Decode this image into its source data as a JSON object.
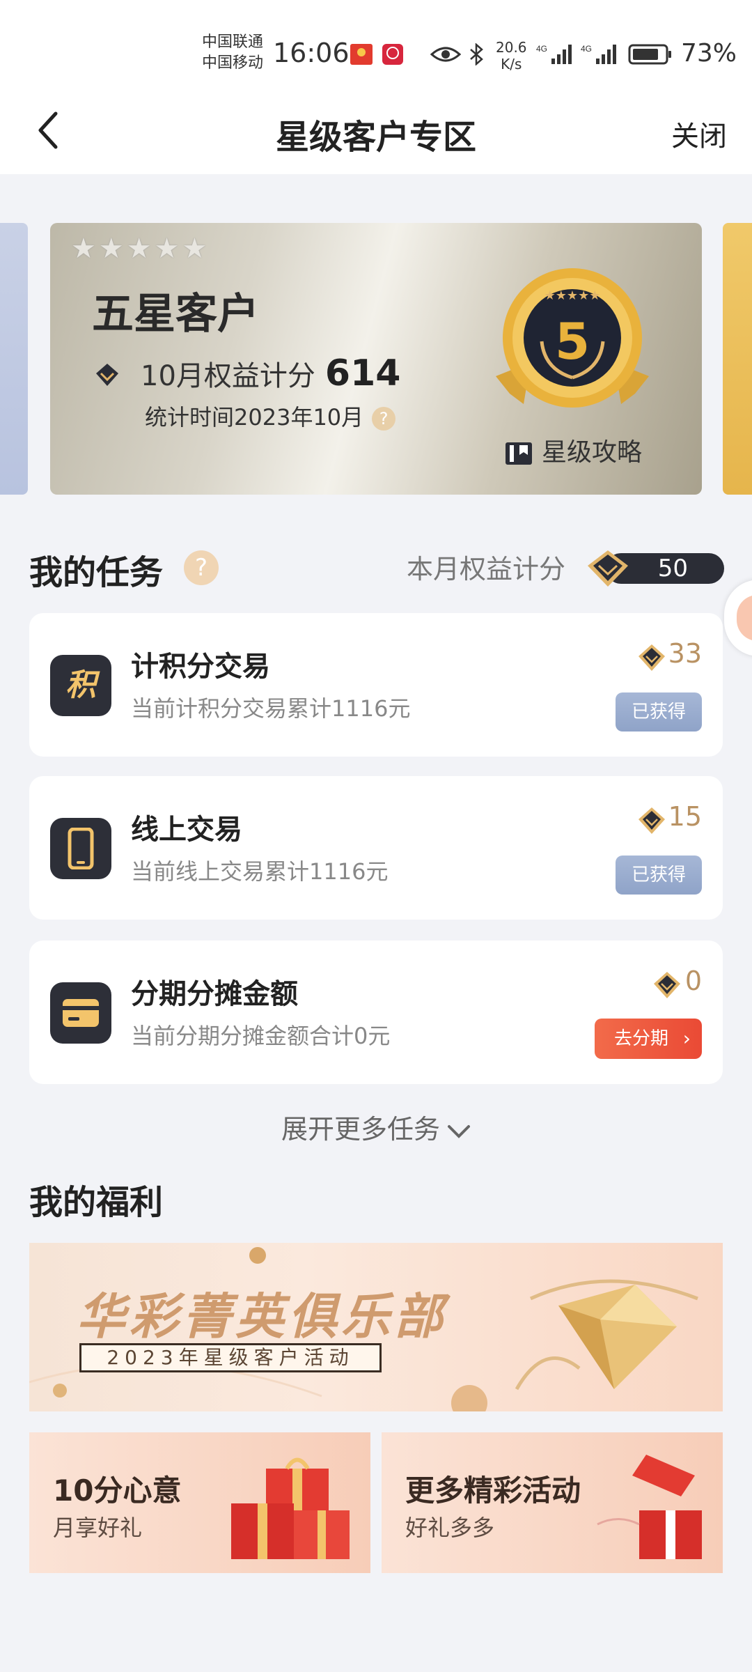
{
  "status": {
    "carrier1": "中国联通",
    "carrier2": "中国移动",
    "time": "16:06",
    "net_speed_value": "20.6",
    "net_speed_unit": "K/s",
    "signal1": "4G",
    "signal2": "4G",
    "battery": "73%"
  },
  "header": {
    "title": "星级客户专区",
    "close_label": "关闭"
  },
  "star_card": {
    "stars": "★★★★★",
    "level_name": "五星客户",
    "points_label": "10月权益计分",
    "points_value": "614",
    "stat_time": "统计时间2023年10月",
    "help": "?",
    "medal_level": "5",
    "guide_label": "星级攻略"
  },
  "tasks": {
    "section_title": "我的任务",
    "help": "?",
    "month_points_label": "本月权益计分",
    "month_points_value": "50",
    "items": [
      {
        "icon_char": "积",
        "name": "计积分交易",
        "desc": "当前计积分交易累计1116元",
        "score": "33",
        "action": "已获得"
      },
      {
        "icon_char": "",
        "name": "线上交易",
        "desc": "当前线上交易累计1116元",
        "score": "15",
        "action": "已获得"
      },
      {
        "icon_char": "",
        "name": "分期分摊金额",
        "desc": "当前分期分摊金额合计0元",
        "score": "0",
        "action": "去分期"
      }
    ],
    "more_label": "展开更多任务"
  },
  "benefits": {
    "section_title": "我的福利",
    "banner_title": "华彩菁英俱乐部",
    "banner_sub": "2023年星级客户活动",
    "tiles": [
      {
        "title": "10分心意",
        "sub": "月享好礼"
      },
      {
        "title": "更多精彩活动",
        "sub": "好礼多多"
      }
    ]
  },
  "colors": {
    "accent_gold": "#b99263",
    "button_red": "#ea4a35",
    "button_blue": "#8fa3c8",
    "dark_icon": "#2d2f38"
  }
}
